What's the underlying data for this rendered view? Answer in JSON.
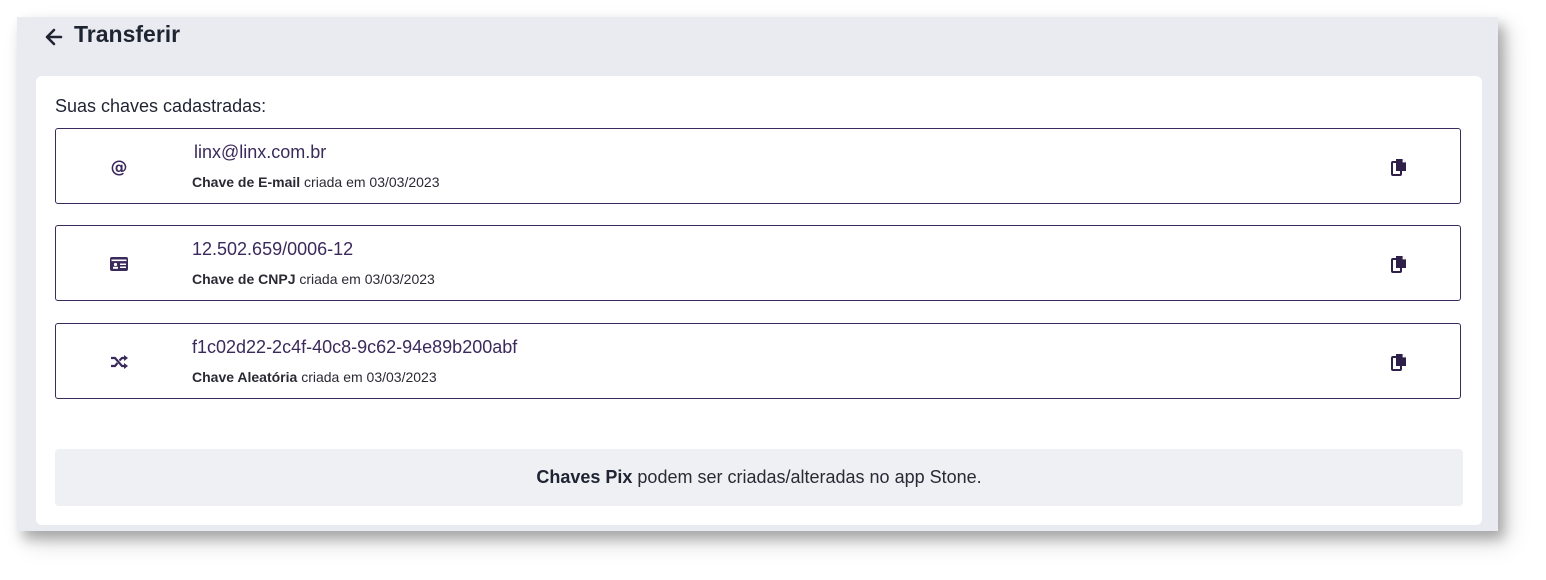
{
  "header": {
    "title": "Transferir",
    "back_icon": "arrow-left-icon"
  },
  "keys_section": {
    "label": "Suas chaves cadastradas:",
    "items": [
      {
        "icon": "at-sign-icon",
        "value": "linx@linx.com.br",
        "type_label": "Chave de E-mail",
        "created_text": "criada em 03/03/2023",
        "copy_icon": "copy-icon"
      },
      {
        "icon": "id-card-icon",
        "value": "12.502.659/0006-12",
        "type_label": "Chave de CNPJ",
        "created_text": "criada em 03/03/2023",
        "copy_icon": "copy-icon"
      },
      {
        "icon": "shuffle-icon",
        "value": "f1c02d22-2c4f-40c8-9c62-94e89b200abf",
        "type_label": "Chave Aleatória",
        "created_text": "criada em 03/03/2023",
        "copy_icon": "copy-icon"
      }
    ]
  },
  "footer": {
    "bold_text": "Chaves Pix",
    "rest_text": " podem ser criadas/alteradas no app Stone."
  },
  "colors": {
    "window_bg": "#e9ebf0",
    "accent": "#3a2a5c",
    "card_bg": "#ffffff",
    "note_bg": "#eef0f4"
  }
}
